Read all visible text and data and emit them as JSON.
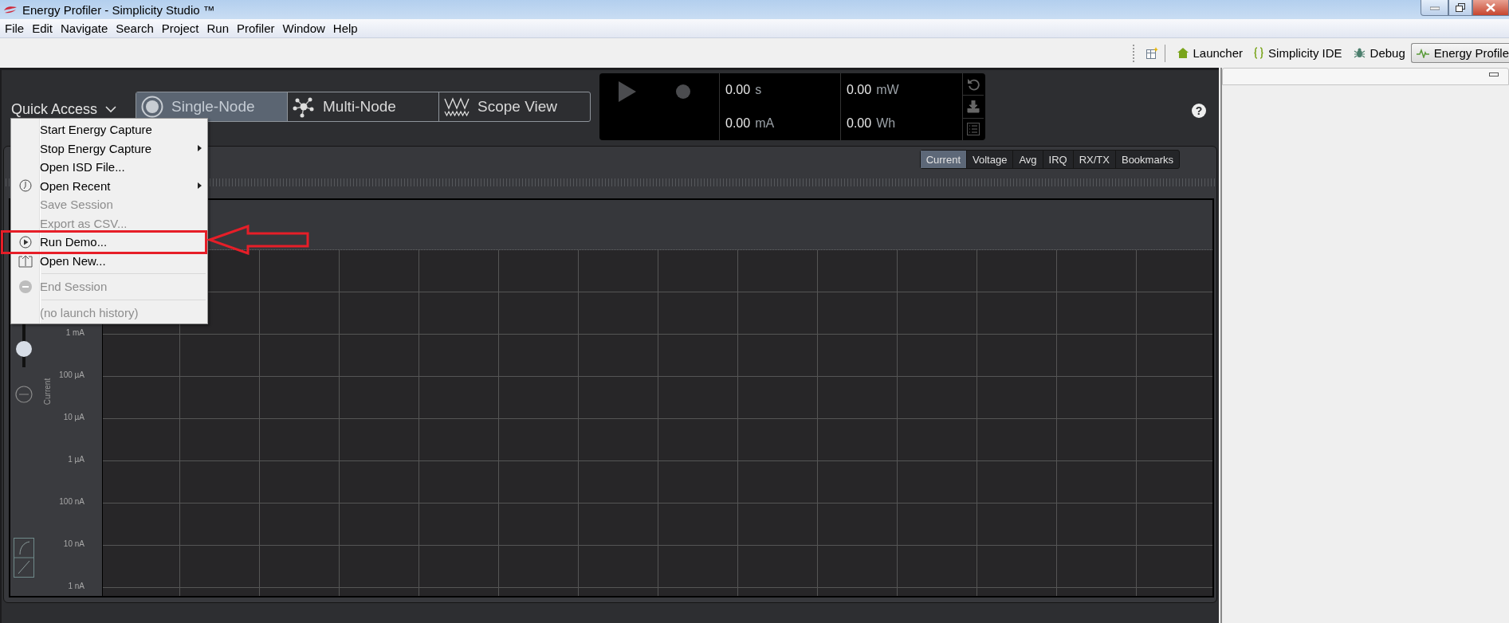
{
  "window": {
    "title": "Energy Profiler - Simplicity Studio ™"
  },
  "menu_bar": [
    "File",
    "Edit",
    "Navigate",
    "Search",
    "Project",
    "Run",
    "Profiler",
    "Window",
    "Help"
  ],
  "perspectives": [
    {
      "label": "Launcher",
      "selected": false
    },
    {
      "label": "Simplicity IDE",
      "selected": false
    },
    {
      "label": "Debug",
      "selected": false
    },
    {
      "label": "Energy Profile",
      "selected": true
    }
  ],
  "quick_access": {
    "label": "Quick Access",
    "expanded": true
  },
  "modes": [
    {
      "label": "Single-Node",
      "selected": true
    },
    {
      "label": "Multi-Node",
      "selected": false
    },
    {
      "label": "Scope View",
      "selected": false
    }
  ],
  "metrics": [
    {
      "value": "0.00",
      "unit": "s"
    },
    {
      "value": "0.00",
      "unit": "mW"
    },
    {
      "value": "0.00",
      "unit": "mA"
    },
    {
      "value": "0.00",
      "unit": "Wh"
    }
  ],
  "help": {
    "label": "?"
  },
  "chart_tabs": [
    {
      "label": "Current",
      "selected": true
    },
    {
      "label": "Voltage",
      "selected": false
    },
    {
      "label": "Avg",
      "selected": false
    },
    {
      "label": "IRQ",
      "selected": false
    },
    {
      "label": "RX/TX",
      "selected": false
    },
    {
      "label": "Bookmarks",
      "selected": false
    }
  ],
  "y_axis": {
    "title": "Current",
    "ticks": [
      "1 mA",
      "100 µA",
      "10 µA",
      "1 µA",
      "100 nA",
      "10 nA",
      "1 nA"
    ]
  },
  "quick_menu": [
    {
      "kind": "item",
      "label": "Start Energy Capture",
      "disabled": false,
      "submenu": false,
      "highlighted": false
    },
    {
      "kind": "item",
      "label": "Stop Energy Capture",
      "disabled": false,
      "submenu": true,
      "highlighted": false
    },
    {
      "kind": "item",
      "label": "Open ISD File...",
      "disabled": false,
      "submenu": false,
      "highlighted": false
    },
    {
      "kind": "item",
      "label": "Open Recent",
      "disabled": false,
      "submenu": true,
      "highlighted": false
    },
    {
      "kind": "item",
      "label": "Save Session",
      "disabled": true,
      "submenu": false,
      "highlighted": false
    },
    {
      "kind": "item",
      "label": "Export as CSV...",
      "disabled": true,
      "submenu": false,
      "highlighted": false
    },
    {
      "kind": "item",
      "label": "Run Demo...",
      "disabled": false,
      "submenu": false,
      "highlighted": true
    },
    {
      "kind": "item",
      "label": "Open New...",
      "disabled": false,
      "submenu": false,
      "highlighted": false
    },
    {
      "kind": "separator"
    },
    {
      "kind": "item",
      "label": "End Session",
      "disabled": true,
      "submenu": false,
      "highlighted": false
    },
    {
      "kind": "separator"
    },
    {
      "kind": "item",
      "label": "(no launch history)",
      "disabled": true,
      "submenu": false,
      "highlighted": false
    }
  ]
}
